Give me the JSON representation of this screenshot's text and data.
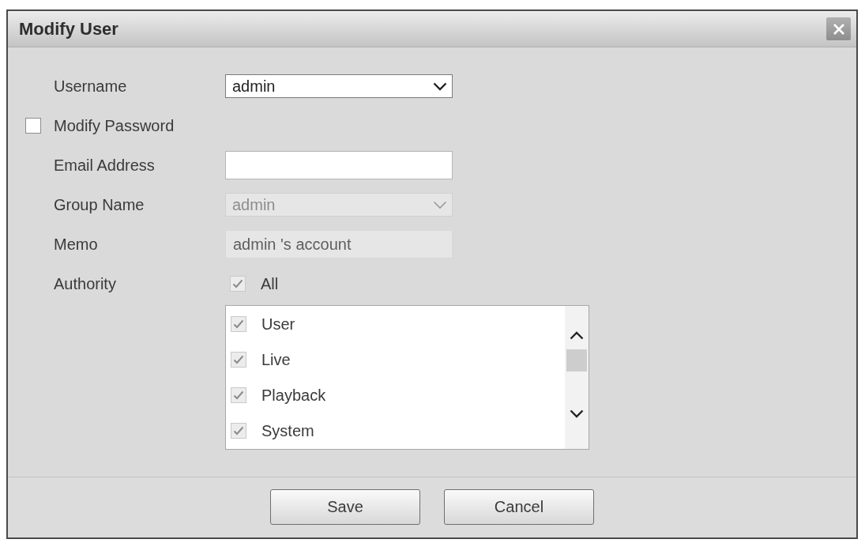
{
  "dialog": {
    "title": "Modify User"
  },
  "fields": [
    {
      "kind": "select",
      "label": "Username",
      "value": "admin",
      "disabled": false
    },
    {
      "kind": "checkbox",
      "label": "Modify Password",
      "checked": false
    },
    {
      "kind": "text",
      "label": "Email Address",
      "disabled": false
    },
    {
      "kind": "select",
      "label": "Group Name",
      "value": "admin",
      "disabled": true
    },
    {
      "kind": "text",
      "label": "Memo",
      "value": "admin 's account",
      "disabled": true
    },
    {
      "kind": "checklist",
      "label": "Authority",
      "all": {
        "label": "All",
        "checked": true,
        "disabled": true
      },
      "items": [
        {
          "label": "User",
          "checked": true,
          "disabled": true
        },
        {
          "label": "Live",
          "checked": true,
          "disabled": true
        },
        {
          "label": "Playback",
          "checked": true,
          "disabled": true
        },
        {
          "label": "System",
          "checked": true,
          "disabled": true
        }
      ]
    }
  ],
  "buttons": [
    {
      "label": "Save"
    },
    {
      "label": "Cancel"
    }
  ]
}
